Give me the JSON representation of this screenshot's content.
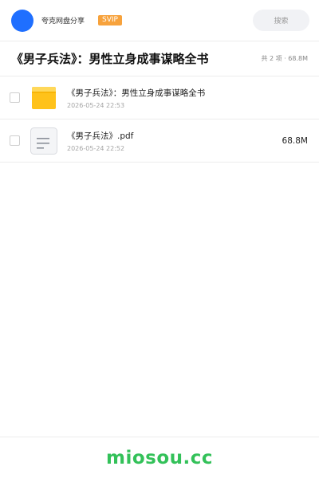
{
  "header": {
    "app_name": "夸克网盘分享",
    "badge": "SVIP",
    "search_placeholder": "搜索",
    "avatar_color": "#1f6fff"
  },
  "share": {
    "title": "《男子兵法》：男性立身成事谋略全书",
    "summary": "共 2 项 · 68.8M"
  },
  "files": [
    {
      "type": "folder",
      "icon": "folder-icon",
      "name": "《男子兵法》：男性立身成事谋略全书",
      "date": "2026-05-24 22:53",
      "size": ""
    },
    {
      "type": "pdf",
      "icon": "document-icon",
      "name": "《男子兵法》.pdf",
      "date": "2026-05-24 22:52",
      "size": "68.8M"
    }
  ],
  "watermark": "miosou.cc",
  "colors": {
    "accent": "#1f6fff",
    "svip": "#f7a23c",
    "folder": "#ffc21a",
    "watermark": "#33c159"
  }
}
